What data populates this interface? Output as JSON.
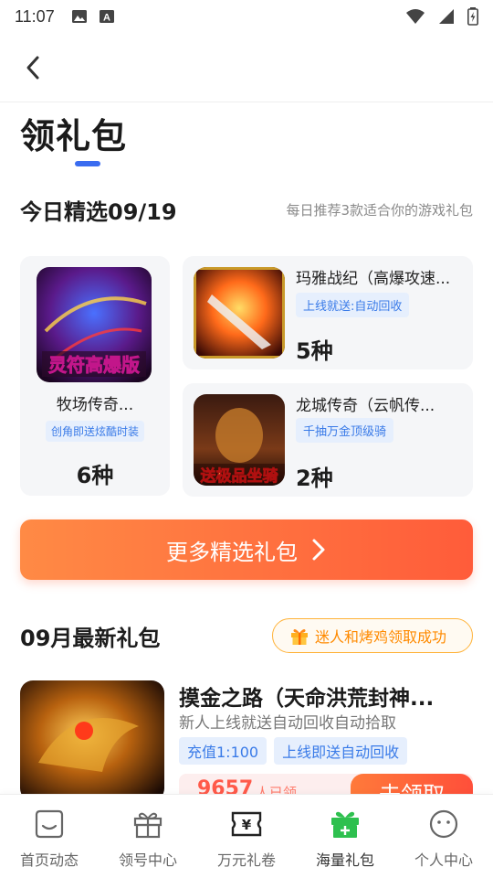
{
  "status_bar": {
    "time": "11:07"
  },
  "header": {
    "title": "领礼包"
  },
  "today": {
    "title": "今日精选09/19",
    "subtitle": "每日推荐3款适合你的游戏礼包",
    "cards": [
      {
        "name": "牧场传奇...",
        "tag": "创角即送炫酷时装",
        "count": "6种",
        "icon_text": "灵符高爆版"
      },
      {
        "name": "玛雅战纪（高爆攻速...",
        "tag": "上线就送:自动回收",
        "count": "5种"
      },
      {
        "name": "龙城传奇（云帆传...",
        "tag": "千抽万金顶级骑",
        "count": "2种",
        "icon_text": "送极品坐骑"
      }
    ]
  },
  "more_button": {
    "label": "更多精选礼包"
  },
  "latest": {
    "title": "09月最新礼包",
    "notice": "迷人和烤鸡领取成功",
    "gift": {
      "name": "摸金之路（天命洪荒封神...",
      "desc": "新人上线就送自动回收自动拾取",
      "tags": [
        "充值1:100",
        "上线即送自动回收"
      ],
      "remaining": "9657",
      "remaining_suffix": "人已领",
      "claim_label": "去领取"
    }
  },
  "tabs": [
    {
      "label": "首页动态",
      "icon": "home-icon"
    },
    {
      "label": "领号中心",
      "icon": "gift-box-icon"
    },
    {
      "label": "万元礼卷",
      "icon": "voucher-icon"
    },
    {
      "label": "海量礼包",
      "icon": "green-gift-icon",
      "active": true
    },
    {
      "label": "个人中心",
      "icon": "face-icon"
    }
  ],
  "colors": {
    "accent": "#3a6cf0",
    "orange": "#ff6a3d",
    "tag_blue": "#3a7be8",
    "green": "#2ec04f"
  }
}
